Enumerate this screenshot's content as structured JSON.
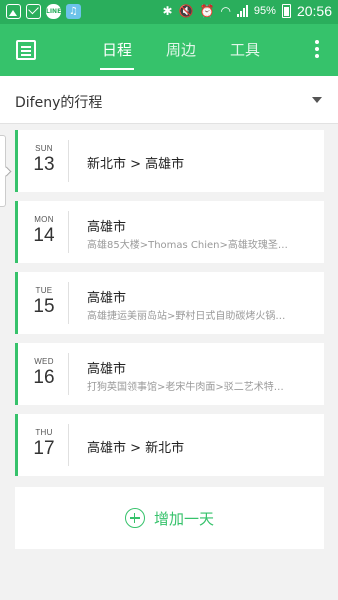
{
  "status_bar": {
    "battery": "95%",
    "time": "20:56",
    "line_badge": "LINE"
  },
  "appbar": {
    "tabs": [
      {
        "label": "日程",
        "active": true
      },
      {
        "label": "周边",
        "active": false
      },
      {
        "label": "工具",
        "active": false
      }
    ],
    "accent_color": "#36c26b"
  },
  "trip": {
    "title": "Difeny的行程"
  },
  "days": [
    {
      "weekday": "SUN",
      "date": "13",
      "title": "新北市 > 高雄市",
      "subtitle": ""
    },
    {
      "weekday": "MON",
      "date": "14",
      "title": "高雄市",
      "subtitle": "高雄85大楼>Thomas Chien>高雄玫瑰圣…"
    },
    {
      "weekday": "TUE",
      "date": "15",
      "title": "高雄市",
      "subtitle": "高雄捷运美丽岛站>野村日式自助碳烤火锅…"
    },
    {
      "weekday": "WED",
      "date": "16",
      "title": "高雄市",
      "subtitle": "打狗英国领事馆>老宋牛肉面>驳二艺术特…"
    },
    {
      "weekday": "THU",
      "date": "17",
      "title": "高雄市 > 新北市",
      "subtitle": ""
    }
  ],
  "add_day": {
    "label": "增加一天"
  }
}
